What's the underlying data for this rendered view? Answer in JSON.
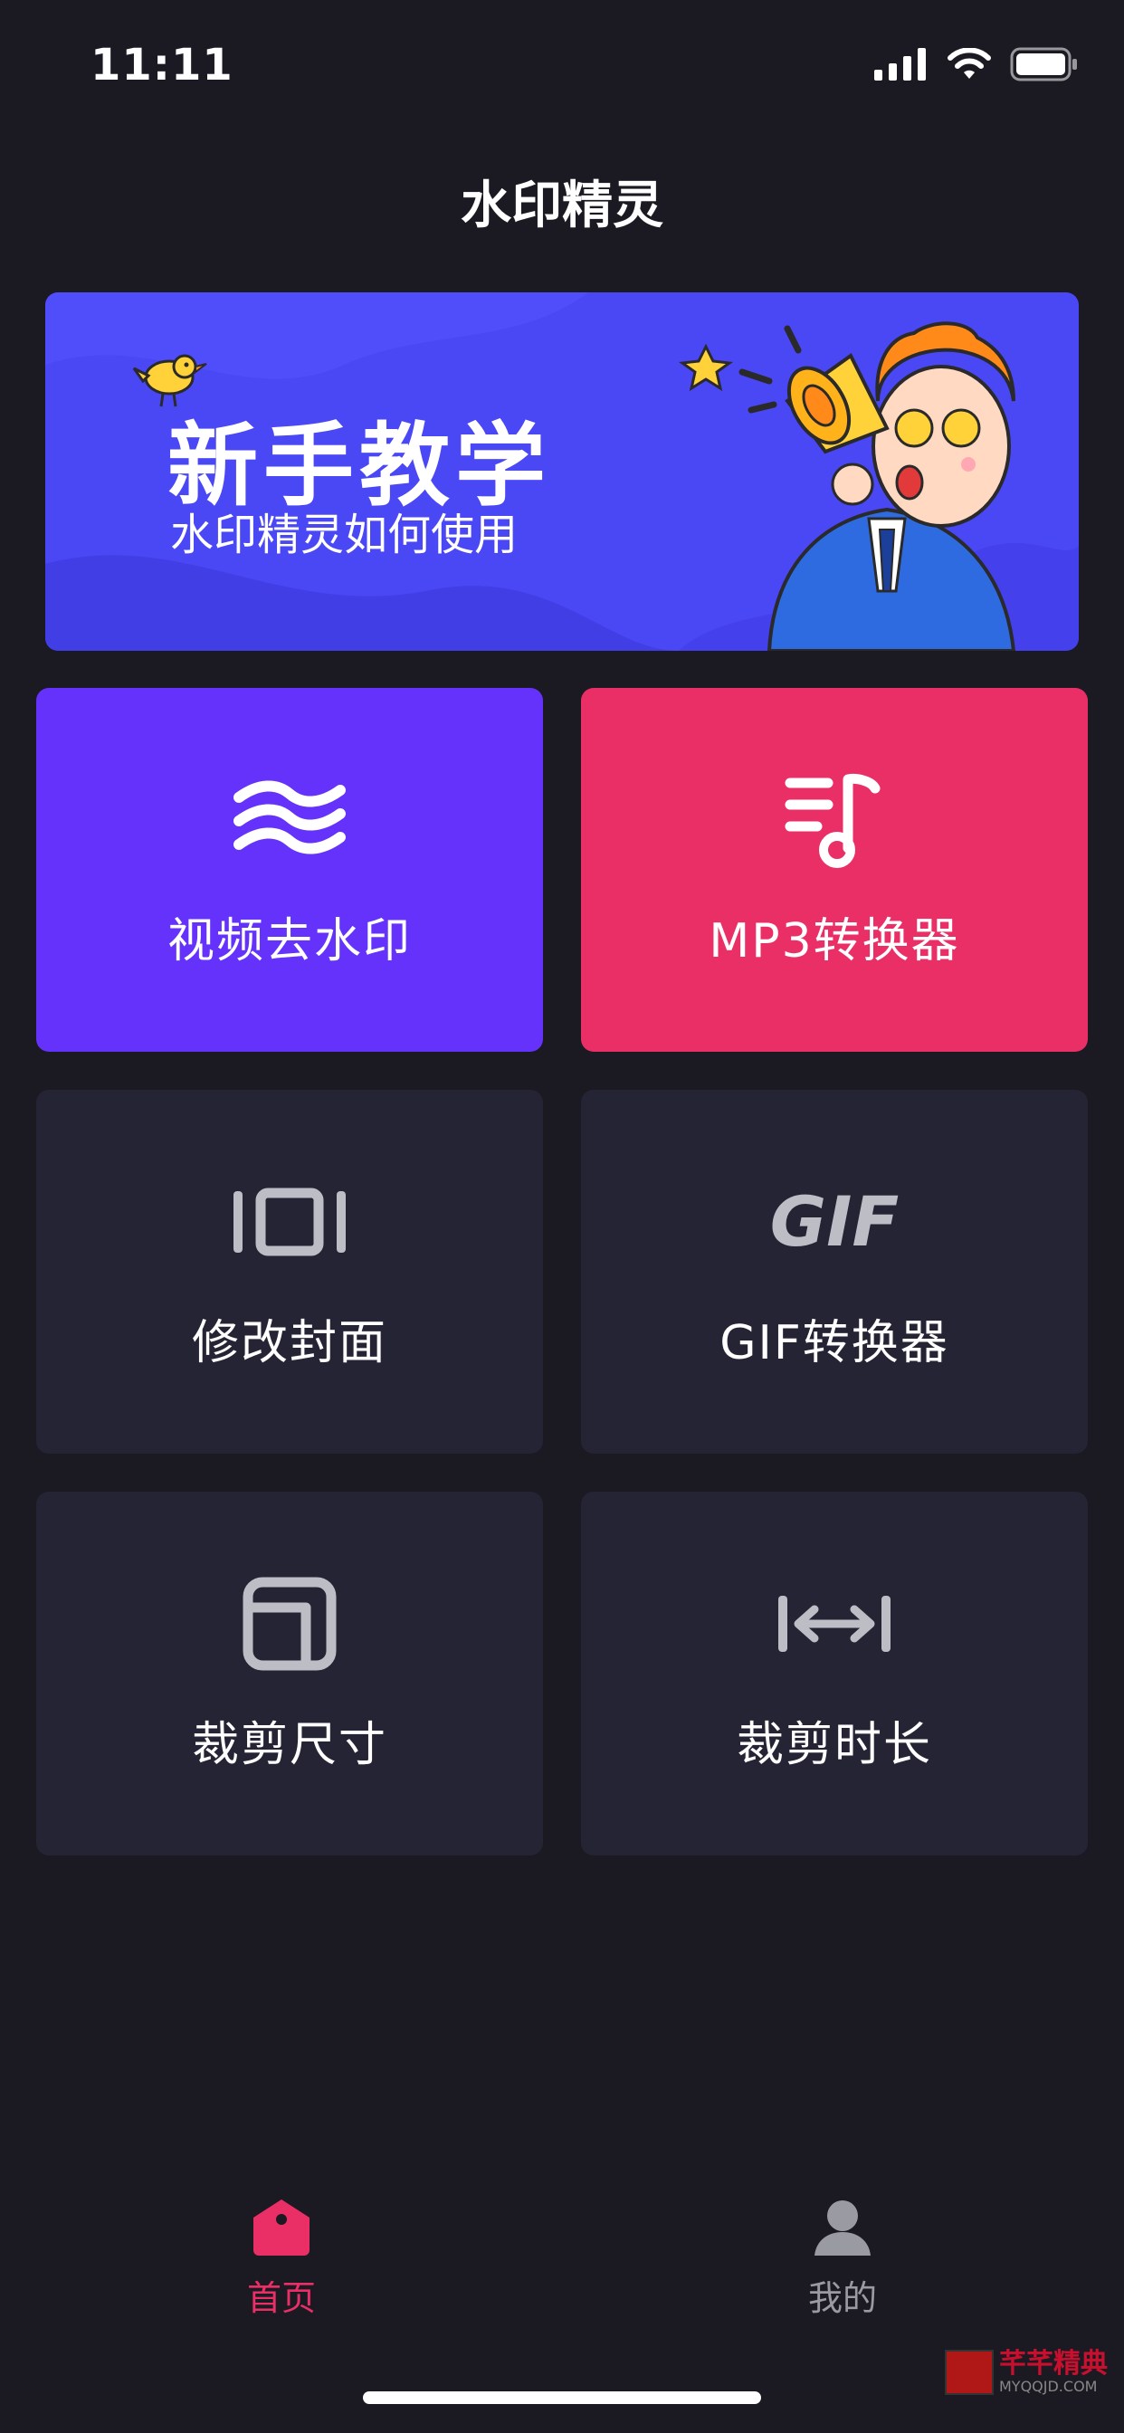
{
  "status_bar": {
    "time": "11:11"
  },
  "header": {
    "title": "水印精灵"
  },
  "banner": {
    "title": "新手教学",
    "subtitle": "水印精灵如何使用",
    "bg_color": "#4a47f5"
  },
  "tiles": [
    {
      "label": "视频去水印",
      "icon": "waves-icon",
      "color": "#6432fa"
    },
    {
      "label": "MP3转换器",
      "icon": "music-note-icon",
      "color": "#ea2f66"
    },
    {
      "label": "修改封面",
      "icon": "cover-frame-icon",
      "color": "#252434"
    },
    {
      "label": "GIF转换器",
      "icon": "gif-icon",
      "icon_text": "GIF",
      "color": "#252434"
    },
    {
      "label": "裁剪尺寸",
      "icon": "crop-size-icon",
      "color": "#252434"
    },
    {
      "label": "裁剪时长",
      "icon": "trim-duration-icon",
      "color": "#252434"
    }
  ],
  "tab_bar": {
    "items": [
      {
        "label": "首页",
        "icon": "home-icon",
        "active": true
      },
      {
        "label": "我的",
        "icon": "user-icon",
        "active": false
      }
    ],
    "active_color": "#ea2f66",
    "inactive_color": "#9a9aa3"
  },
  "watermark": {
    "cn": "芊芊精典",
    "en": "MYQQJD.COM"
  }
}
